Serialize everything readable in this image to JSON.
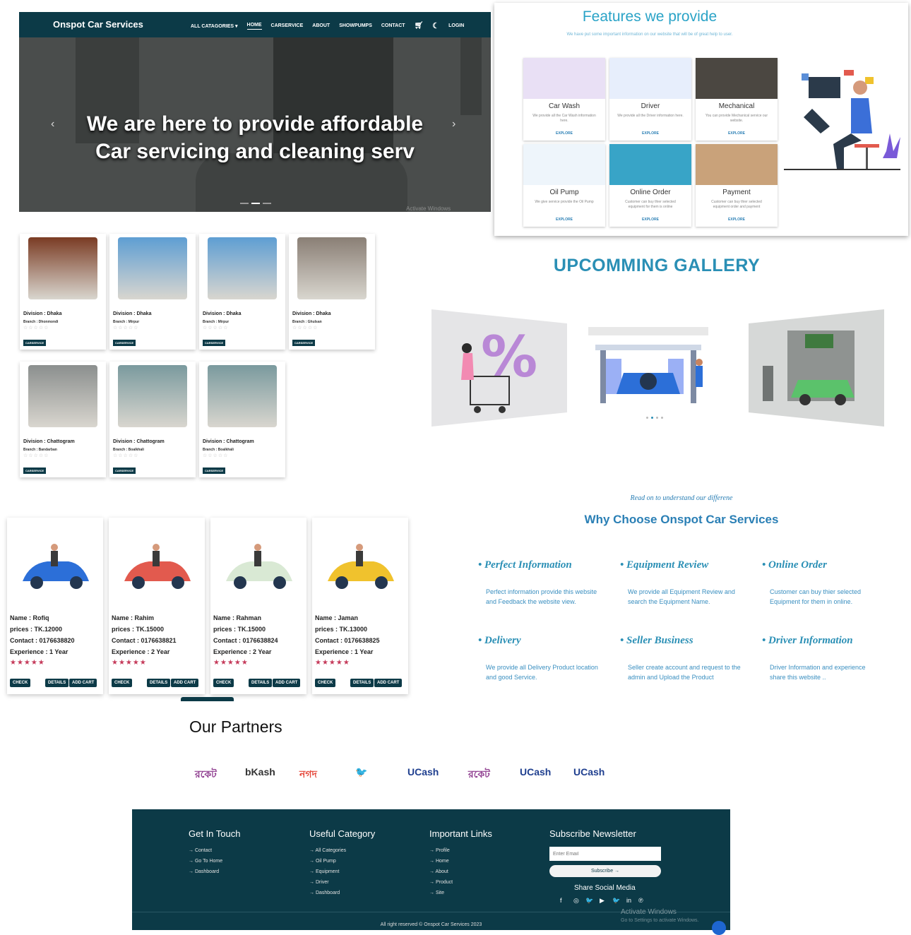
{
  "hero": {
    "brand": "Onspot Car Services",
    "nav": [
      "ALL CATAGORIES ▾",
      "HOME",
      "CARSERVICE",
      "ABOUT",
      "SHOWPUMPS",
      "CONTACT",
      "LOGIN"
    ],
    "title_line1": "We are here to provide affordable",
    "title_line2": "Car servicing and cleaning serv",
    "prev": "‹",
    "next": "›",
    "watermark": "Activate Windows"
  },
  "features": {
    "title": "Features we provide",
    "subtitle": "We have put some important information on our website that will be of great help to user.",
    "cards": [
      {
        "title": "Car Wash",
        "desc": "We provide all the Car Wash information here.",
        "link": "EXPLORE",
        "color": "#e9e0f5"
      },
      {
        "title": "Driver",
        "desc": "We provide all the Driver information here.",
        "link": "EXPLORE",
        "color": "#e7eefc"
      },
      {
        "title": "Mechanical",
        "desc": "You can provide Mechanical service our website.",
        "link": "EXPLORE",
        "color": "#4b4741"
      },
      {
        "title": "Oil Pump",
        "desc": "We give service provide the Oil Pump",
        "link": "EXPLORE",
        "color": "#eef5fb"
      },
      {
        "title": "Online Order",
        "desc": "Customer can buy thier selected equipment for them is online",
        "link": "EXPLORE",
        "color": "#38a4c7"
      },
      {
        "title": "Payment",
        "desc": "Customer can buy thier selected equipment order and payment",
        "link": "EXPLORE",
        "color": "#c9a27a"
      }
    ]
  },
  "branches": [
    {
      "division": "Division : Dhaka",
      "branch": "Branch : Dhonmondi",
      "btn": "CARSERVICE",
      "img": "#7a3b23"
    },
    {
      "division": "Division : Dhaka",
      "branch": "Branch : Mirpur",
      "btn": "CARSERVICE",
      "img": "#5e9ed3"
    },
    {
      "division": "Division : Dhaka",
      "branch": "Branch : Mirpur",
      "btn": "CARSERVICE",
      "img": "#5e9ed3"
    },
    {
      "division": "Division : Dhaka",
      "branch": "Branch : Ghulsan",
      "btn": "CARSERVICE",
      "img": "#8a7f75"
    },
    {
      "division": "Division : Chattogram",
      "branch": "Branch : Bandarban",
      "btn": "CARSERVICE",
      "img": "#8b8f8e"
    },
    {
      "division": "Division : Chattogram",
      "branch": "Branch : Boalkhali",
      "btn": "CARSERVICE",
      "img": "#7a9a9e"
    },
    {
      "division": "Division : Chattogram",
      "branch": "Branch : Boalkhali",
      "btn": "CARSERVICE",
      "img": "#7a9a9e"
    }
  ],
  "stars_text": "☆☆☆☆☆",
  "gallery": {
    "title": "UPCOMMING GALLERY"
  },
  "mechanics": [
    {
      "name": "Name : Rofiq",
      "price": "prices : TK.12000",
      "contact": "Contact : 0176638820",
      "exp": "Experience : 1 Year",
      "car": "#2c6fd8"
    },
    {
      "name": "Name : Rahim",
      "price": "prices : TK.15000",
      "contact": "Contact : 0176638821",
      "exp": "Experience : 2 Year",
      "car": "#e25a4e"
    },
    {
      "name": "Name : Rahman",
      "price": "prices : TK.15000",
      "contact": "Contact : 0176638824",
      "exp": "Experience : 2 Year",
      "car": "#d9e9d4"
    },
    {
      "name": "Name : Jaman",
      "price": "prices : TK.13000",
      "contact": "Contact : 0176638825",
      "exp": "Experience : 1 Year",
      "car": "#f0c22d"
    }
  ],
  "mech_stars": "★★★★★",
  "mech_buttons": {
    "check": "CHECK",
    "details": "DETAILS",
    "cart": "ADD CART"
  },
  "why": {
    "read": "Read on to understand our differene",
    "title": "Why Choose Onspot Car Services",
    "items": [
      {
        "h": "• Perfect Information",
        "d": "Perfect information provide this website and Feedback the website view."
      },
      {
        "h": "• Equipment Review",
        "d": "We provide all Equipment Review and search the Equipment Name."
      },
      {
        "h": "• Online Order",
        "d": "Customer can buy thier selected Equipment for them in online."
      },
      {
        "h": "• Delivery",
        "d": "We provide all Delivery Product location and good Service."
      },
      {
        "h": "• Seller Business",
        "d": "Seller create account and request to the admin and Upload the Product"
      },
      {
        "h": "• Driver Information",
        "d": "Driver Information and experience share this website .."
      }
    ]
  },
  "partners": {
    "title": "Our Partners",
    "logos": [
      {
        "text": "রকেট",
        "color": "#8e3c8f"
      },
      {
        "text": "bKash",
        "color": "#333333"
      },
      {
        "text": "নগদ",
        "color": "#e5473a"
      },
      {
        "text": "🐦",
        "color": "#8e3c8f"
      },
      {
        "text": "UCash",
        "color": "#1f3f8f"
      },
      {
        "text": "রকেট",
        "color": "#8e3c8f"
      },
      {
        "text": "UCash",
        "color": "#1f3f8f"
      },
      {
        "text": "UCash",
        "color": "#1f3f8f"
      }
    ]
  },
  "footer": {
    "get_in_touch": "Get In Touch",
    "git_links": [
      "→ Contact",
      "→ Go To Home",
      "→ Dashboard"
    ],
    "useful": "Useful Category",
    "useful_links": [
      "→ All Categories",
      "→ Oil Pump",
      "→ Equipment",
      "→ Driver",
      "→ Dashboard"
    ],
    "important": "Important Links",
    "important_links": [
      "→ Profile",
      "→ Home",
      "→ About",
      "→ Product",
      "→ Site"
    ],
    "newsletter": "Subscribe Newsletter",
    "email_placeholder": "Enter Email",
    "subscribe": "Subscribe →",
    "share": "Share Social Media",
    "social": [
      "f",
      "◎",
      "🐦",
      "▶",
      "🐦",
      "in",
      "℗"
    ],
    "copyright": "All right reserved © Onspot Car Services 2023",
    "activate1": "Activate Windows",
    "activate2": "Go to Settings to activate Windows."
  }
}
